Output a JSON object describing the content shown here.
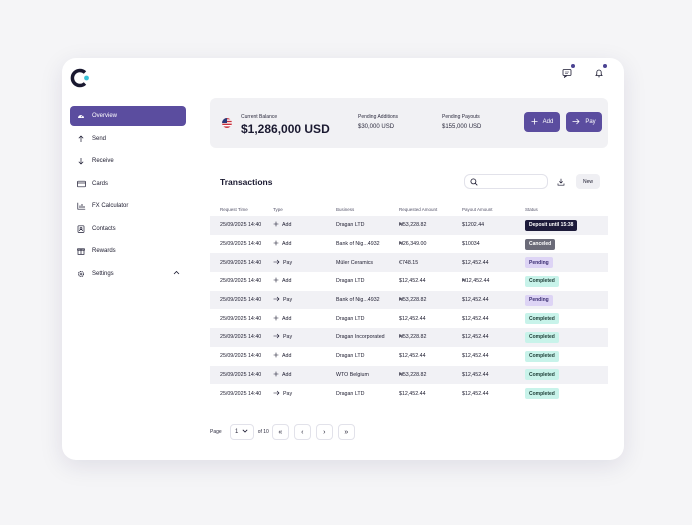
{
  "header": {
    "notifications_icon": "bell-icon",
    "messages_icon": "message-icon"
  },
  "sidebar": {
    "items": [
      {
        "label": "Overview",
        "icon": "dashboard-icon",
        "active": true
      },
      {
        "label": "Send",
        "icon": "arrow-up-icon"
      },
      {
        "label": "Receive",
        "icon": "arrow-down-icon"
      },
      {
        "label": "Cards",
        "icon": "card-icon"
      },
      {
        "label": "FX Calculator",
        "icon": "chart-icon"
      },
      {
        "label": "Contacts",
        "icon": "contacts-icon"
      },
      {
        "label": "Rewards",
        "icon": "gift-icon"
      },
      {
        "label": "Settings",
        "icon": "gear-icon",
        "expandable": true
      }
    ]
  },
  "balance": {
    "label": "Current Balance",
    "value": "$1,286,000 USD",
    "pending_additions_label": "Pending  Additions",
    "pending_additions_value": "$30,000 USD",
    "pending_payouts_label": "Pending  Payouts",
    "pending_payouts_value": "$155,000 USD",
    "add_label": "Add",
    "pay_label": "Pay"
  },
  "transactions": {
    "title": "Transactions",
    "search_placeholder": "",
    "new_label": "New",
    "columns": [
      "Request Time",
      "Type",
      "Business",
      "Requested Amount",
      "Payout Amount",
      "Status"
    ],
    "rows": [
      {
        "time": "25/09/2025 14:40",
        "type": "Add",
        "business": "Dragan LTD",
        "requested": "₦53,228.82",
        "payout": "$1202.44",
        "status": "Deposit until 15:38",
        "status_kind": "deposit"
      },
      {
        "time": "25/09/2025 14:40",
        "type": "Add",
        "business": "Bank of Nig...4932",
        "requested": "₦26,349.00",
        "payout": "$10034",
        "status": "Canceled",
        "status_kind": "canceled"
      },
      {
        "time": "25/09/2025 14:40",
        "type": "Pay",
        "business": "Müler Ceramics",
        "requested": "€748.15",
        "payout": "$12,452.44",
        "status": "Pending",
        "status_kind": "pending"
      },
      {
        "time": "25/09/2025 14:40",
        "type": "Add",
        "business": "Dragan LTD",
        "requested": "$12,452.44",
        "payout": "₦12,452.44",
        "status": "Completed",
        "status_kind": "completed"
      },
      {
        "time": "25/09/2025 14:40",
        "type": "Pay",
        "business": "Bank of Nig...4932",
        "requested": "₦53,228.82",
        "payout": "$12,452.44",
        "status": "Pending",
        "status_kind": "pending"
      },
      {
        "time": "25/09/2025 14:40",
        "type": "Add",
        "business": "Dragan LTD",
        "requested": "$12,452.44",
        "payout": "$12,452.44",
        "status": "Completed",
        "status_kind": "completed"
      },
      {
        "time": "25/09/2025 14:40",
        "type": "Pay",
        "business": "Dragan Incorporated",
        "requested": "₦53,228.82",
        "payout": "$12,452.44",
        "status": "Completed",
        "status_kind": "completed"
      },
      {
        "time": "25/09/2025 14:40",
        "type": "Add",
        "business": "Dragan LTD",
        "requested": "$12,452.44",
        "payout": "$12,452.44",
        "status": "Completed",
        "status_kind": "completed"
      },
      {
        "time": "25/09/2025 14:40",
        "type": "Add",
        "business": "WTO Belgium",
        "requested": "₦53,228.82",
        "payout": "$12,452.44",
        "status": "Completed",
        "status_kind": "completed"
      },
      {
        "time": "25/09/2025 14:40",
        "type": "Pay",
        "business": "Dragan LTD",
        "requested": "$12,452.44",
        "payout": "$12,452.44",
        "status": "Completed",
        "status_kind": "completed"
      }
    ]
  },
  "pagination": {
    "page_label": "Page",
    "current": "1",
    "of_label": "of 10"
  },
  "colors": {
    "accent": "#5b4d9f",
    "completed": "#c8f3ea",
    "pending": "#ddd4f5",
    "canceled": "#6b6b78",
    "deposit": "#1d1b3a"
  }
}
